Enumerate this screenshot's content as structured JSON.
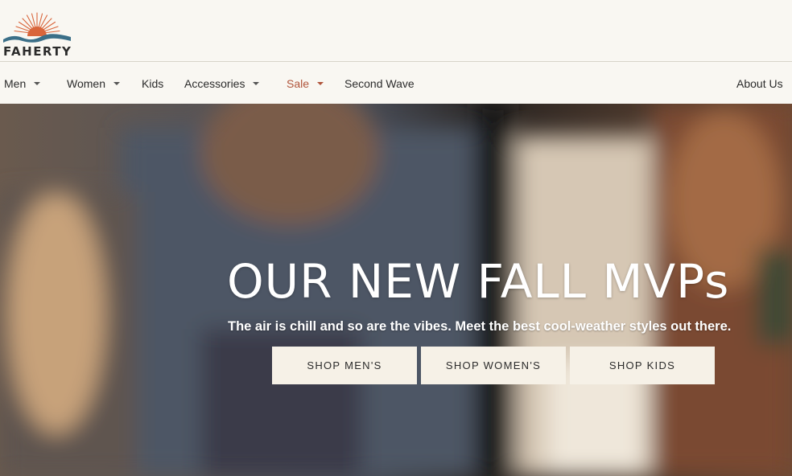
{
  "brand": {
    "name": "FAHERTY",
    "colors": {
      "sun": "#d9653b",
      "wave": "#3b6f88",
      "text": "#2b2b2b"
    }
  },
  "nav": {
    "items": [
      {
        "label": "Men",
        "has_dropdown": true
      },
      {
        "label": "Women",
        "has_dropdown": true
      },
      {
        "label": "Kids",
        "has_dropdown": false
      },
      {
        "label": "Accessories",
        "has_dropdown": true
      },
      {
        "label": "Sale",
        "has_dropdown": true,
        "color": "#b0543a"
      },
      {
        "label": "Second Wave",
        "has_dropdown": false
      }
    ],
    "about": "About Us"
  },
  "hero": {
    "title": "OUR NEW FALL MVPs",
    "subtitle": "The air is chill and so are the vibes. Meet the best cool-weather styles out there.",
    "buttons": [
      {
        "label": "SHOP MEN'S"
      },
      {
        "label": "SHOP WOMEN'S"
      },
      {
        "label": "SHOP KIDS"
      }
    ]
  }
}
